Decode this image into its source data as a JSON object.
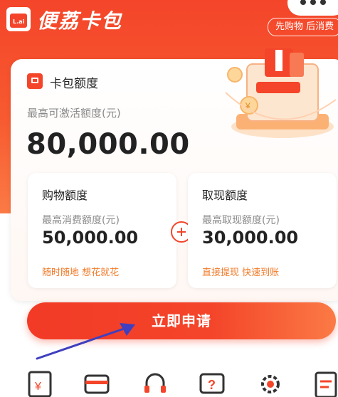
{
  "header": {
    "brand_icon_text": "L.ai",
    "brand_title": "便荔卡包",
    "slogan": "先购物 后消费"
  },
  "card": {
    "title": "卡包额度",
    "max_label": "最高可激活额度(元)",
    "max_amount": "80,000.00"
  },
  "shopping": {
    "title": "购物额度",
    "label": "最高消费额度(元)",
    "amount": "50,000.00",
    "slogan": "随时随地 想花就花"
  },
  "cash": {
    "title": "取现额度",
    "label": "最高取现额度(元)",
    "amount": "30,000.00",
    "slogan": "直接提现 快速到账"
  },
  "action": {
    "apply_label": "立即申请"
  },
  "bottom_icons": [
    "receipt-yuan-icon",
    "card-icon",
    "headset-icon",
    "question-chat-icon",
    "gear-icon",
    "document-icon"
  ],
  "colors": {
    "brand": "#f4452a",
    "accent": "#f07a28",
    "arrow": "#3f3fbf"
  }
}
